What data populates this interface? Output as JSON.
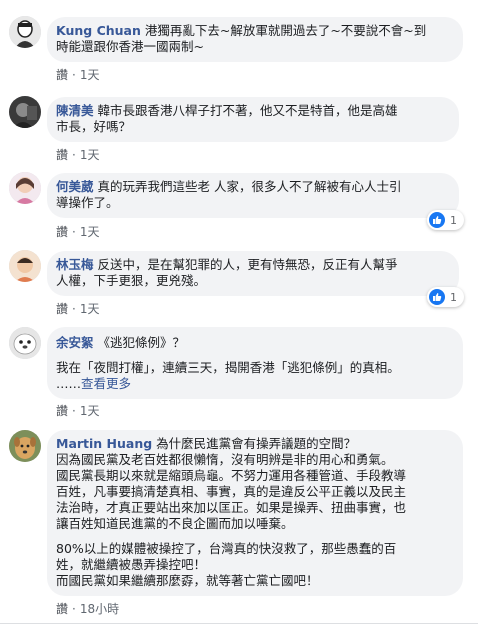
{
  "comments": [
    {
      "name": "Kung Chuan",
      "lines": [
        " 港獨再亂下去~解放軍就開過去了~不要說不會~到",
        "時能還跟你香港一國兩制~"
      ],
      "like_label": "讚",
      "time": "1天"
    },
    {
      "name": "陳清美",
      "lines": [
        " 韓市長跟香港八桿子打不著，他又不是特首，他是高雄",
        "市長，好嗎？"
      ],
      "like_label": "讚",
      "time": "1天"
    },
    {
      "name": "何美葳",
      "lines": [
        " 真的玩弄我們這些老 人家，很多人不了解被有心人士引",
        "導操作了。"
      ],
      "like_label": "讚",
      "time": "1天",
      "reactions": "1"
    },
    {
      "name": "林玉梅",
      "lines": [
        " 反送中，是在幫犯罪的人，更有恃無恐，反正有人幫爭",
        "人權，下手更狠，更兇殘。"
      ],
      "like_label": "讚",
      "time": "1天",
      "reactions": "1"
    },
    {
      "name": "余安絮",
      "lines": [
        " 《逃犯條例》？",
        "",
        "我在「夜問打權」，連續三天，揭開香港「逃犯條例」的真相。"
      ],
      "see_more_prefix": "……",
      "see_more": "查看更多",
      "like_label": "讚",
      "time": "1天"
    },
    {
      "name": "Martin Huang",
      "lines": [
        " 為什麼民進黨會有操弄議題的空間？",
        "因為國民黨及老百姓都很懶惰，沒有明辨是非的用心和勇氣。",
        "國民黨長期以來就是縮頭烏龜。不努力運用各種管道、手段教導",
        "百姓，凡事要搞清楚真相、事實，真的是違反公平正義以及民主",
        "法治時，才真正要站出來加以匡正。如果是操弄、扭曲事實，也",
        "讓百姓知道民進黨的不良企圖而加以唾棄。",
        "",
        "80%以上的媒體被操控了，台灣真的快沒救了，那些愚蠢的百",
        "姓，就繼續被愚弄操控吧！",
        "而國民黨如果繼續那麼孬，就等著亡黨亡國吧！"
      ],
      "like_label": "讚",
      "time": "18小時"
    }
  ],
  "colors": {
    "name": "#385898",
    "bubble": "#f2f3f5",
    "meta": "#606770",
    "like_blue": "#1877f2"
  },
  "icons": [
    "like-thumb-icon"
  ]
}
